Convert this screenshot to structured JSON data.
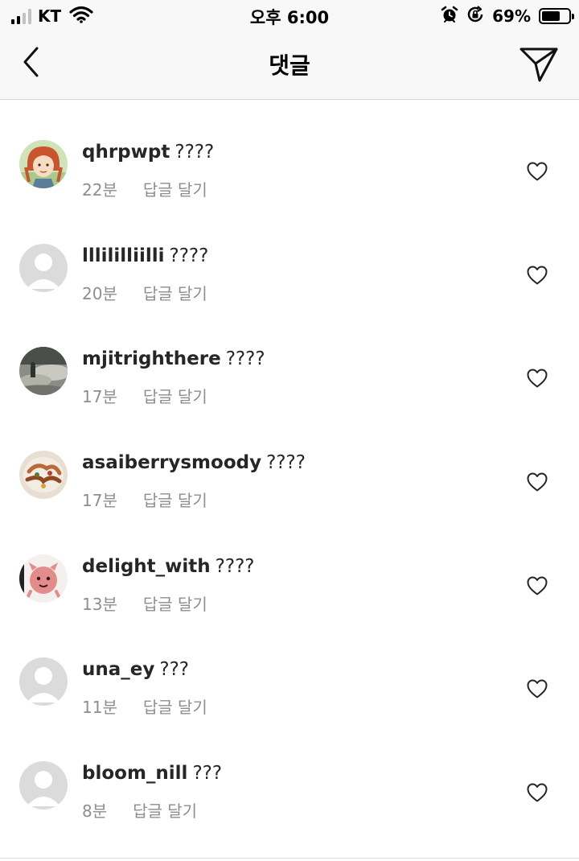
{
  "status_bar": {
    "carrier": "KT",
    "time": "오후 6:00",
    "battery_percent": "69%",
    "battery_level": 0.69,
    "icons": [
      "signal-icon",
      "wifi-icon",
      "alarm-icon",
      "rotation-lock-icon",
      "battery-icon"
    ]
  },
  "header": {
    "title": "댓글",
    "back_icon": "back-chevron-icon",
    "send_icon": "send-icon"
  },
  "comments": [
    {
      "username": "qhrpwpt",
      "text": "????",
      "time": "22분",
      "reply_label": "답글 달기",
      "avatar": "avatar-anime-girl"
    },
    {
      "username": "lllililliilli",
      "text": "????",
      "time": "20분",
      "reply_label": "답글 달기",
      "avatar": "avatar-default"
    },
    {
      "username": "mjitrighthere",
      "text": "????",
      "time": "17분",
      "reply_label": "답글 달기",
      "avatar": "avatar-photo-landscape"
    },
    {
      "username": "asaiberrysmoody",
      "text": "????",
      "time": "17분",
      "reply_label": "답글 달기",
      "avatar": "avatar-photo-food"
    },
    {
      "username": "delight_with",
      "text": "????",
      "time": "13분",
      "reply_label": "답글 달기",
      "avatar": "avatar-pink-character"
    },
    {
      "username": "una_ey",
      "text": "???",
      "time": "11분",
      "reply_label": "답글 달기",
      "avatar": "avatar-default"
    },
    {
      "username": "bloom_nill",
      "text": "???",
      "time": "8분",
      "reply_label": "답글 달기",
      "avatar": "avatar-default"
    }
  ],
  "colors": {
    "text_primary": "#262626",
    "text_secondary": "#8e8e8e",
    "bar_background": "#f8f8f8",
    "divider": "#d6d6d6"
  }
}
